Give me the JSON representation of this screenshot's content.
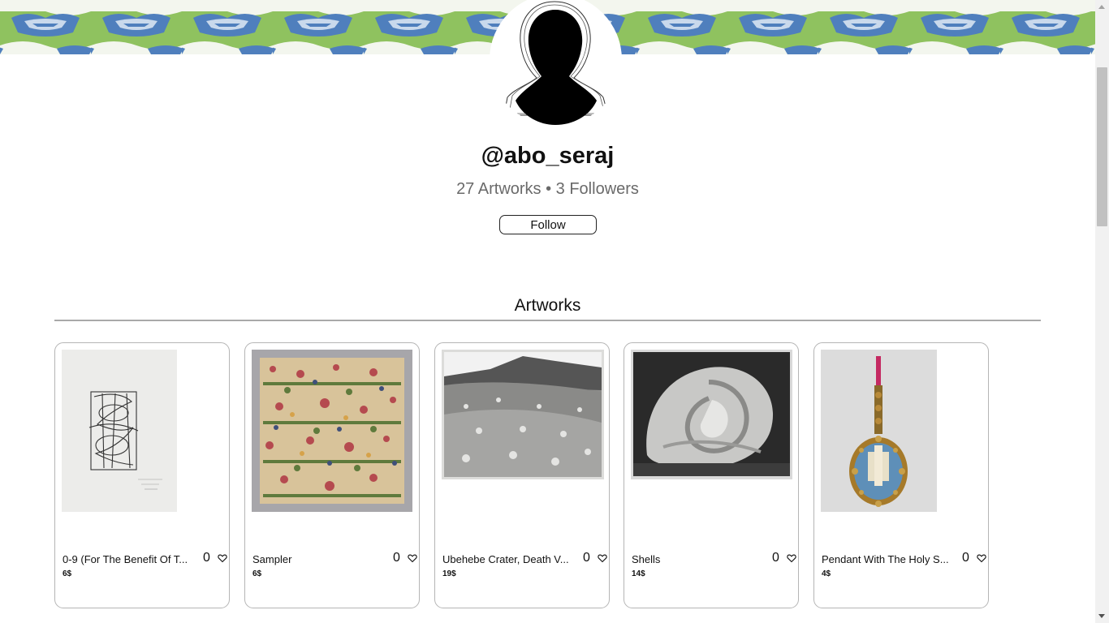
{
  "profile": {
    "username": "@abo_seraj",
    "stats": "27 Artworks • 3 Followers",
    "follow_label": "Follow"
  },
  "section": {
    "title": "Artworks"
  },
  "artworks": [
    {
      "title": "0-9 (For The Benefit Of T...",
      "likes": "0",
      "price": "6$"
    },
    {
      "title": "Sampler",
      "likes": "0",
      "price": "6$"
    },
    {
      "title": "Ubehebe Crater, Death V...",
      "likes": "0",
      "price": "19$"
    },
    {
      "title": "Shells",
      "likes": "0",
      "price": "14$"
    },
    {
      "title": "Pendant With The Holy S...",
      "likes": "0",
      "price": "4$"
    }
  ],
  "icons": {
    "avatar": "person-silhouette-icon",
    "like": "heart-outline-icon"
  },
  "colors": {
    "banner_green": "#8fc25f",
    "banner_blue": "#4f7fbd",
    "rule": "#a9a9a9"
  }
}
